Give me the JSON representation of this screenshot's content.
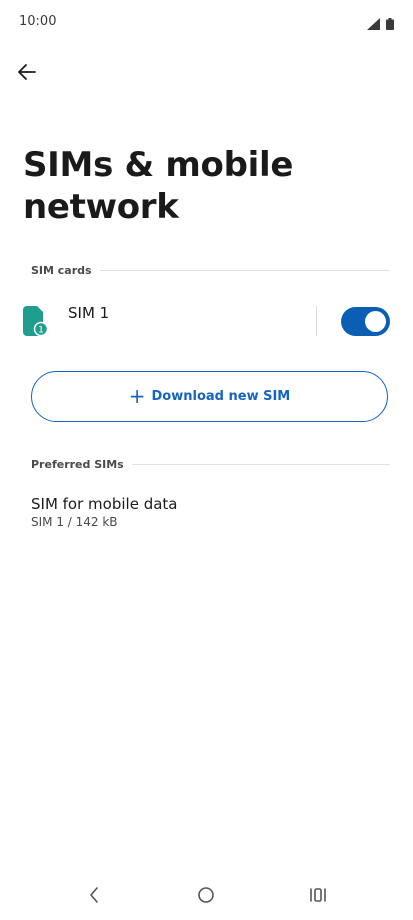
{
  "status_bar": {
    "time": "10:00",
    "icons": [
      "signal-icon",
      "battery-icon"
    ]
  },
  "header": {
    "back_icon": "arrow-left-icon",
    "title": "SIMs & mobile network"
  },
  "sim_cards_section": {
    "header": "SIM cards",
    "items": [
      {
        "label": "SIM 1",
        "icon": "sim-card-icon",
        "badge": "1",
        "enabled": true
      }
    ]
  },
  "download_button": {
    "label": "Download new SIM",
    "icon": "plus-icon"
  },
  "preferred_sims_section": {
    "header": "Preferred SIMs",
    "items": [
      {
        "title": "SIM for mobile data",
        "subtitle": "SIM 1 / 142 kB"
      }
    ]
  },
  "nav_bar": {
    "buttons": [
      "nav-back-icon",
      "nav-home-icon",
      "nav-recents-icon"
    ]
  },
  "colors": {
    "accent": "#1565c0",
    "toggle_on": "#0a5fb4",
    "sim_icon": "#1f9e8e"
  }
}
